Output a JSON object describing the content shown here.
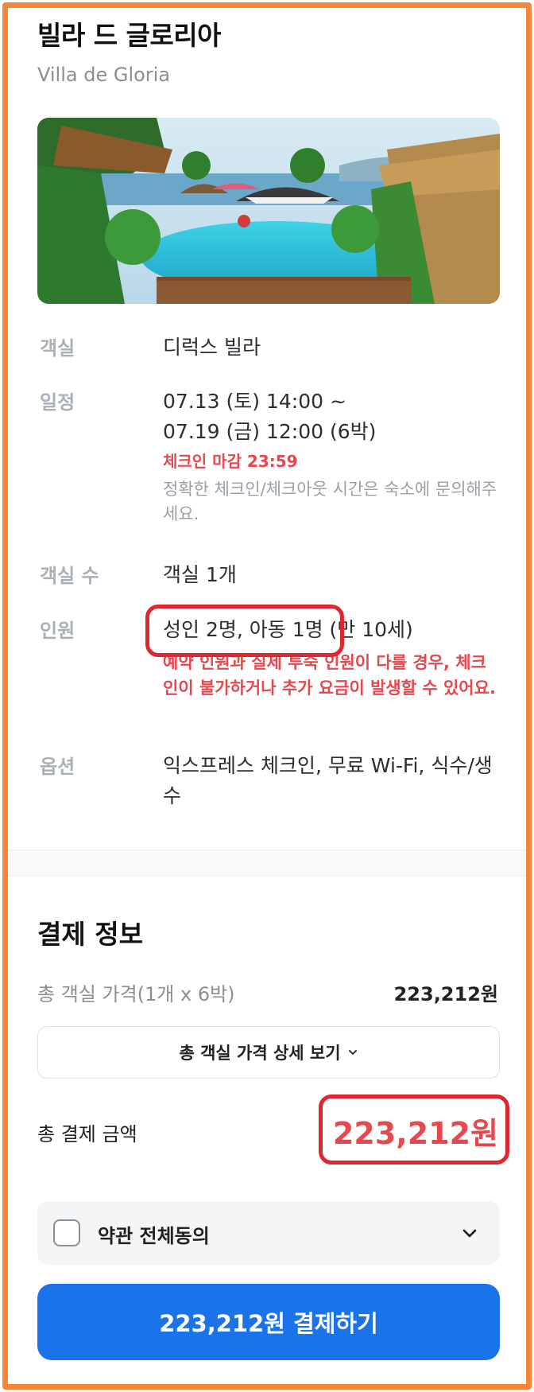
{
  "hotel": {
    "name": "빌라 드 글로리아",
    "name_en": "Villa de Gloria"
  },
  "details": {
    "room": {
      "label": "객실",
      "value": "디럭스 빌라"
    },
    "schedule": {
      "label": "일정",
      "line1": "07.13 (토) 14:00 ~",
      "line2": "07.19 (금) 12:00 (6박)",
      "checkin_deadline": "체크인 마감 23:59",
      "note": "정확한 체크인/체크아웃 시간은 숙소에 문의해주세요."
    },
    "room_count": {
      "label": "객실 수",
      "value": "객실 1개"
    },
    "guests": {
      "label": "인원",
      "value": "성인 2명, 아동 1명 (만 10세)",
      "warning": "예약 인원과 실제 투숙 인원이 다를 경우, 체크인이 불가하거나 추가 요금이 발생할 수 있어요."
    },
    "options": {
      "label": "옵션",
      "value": "익스프레스 체크인, 무료 Wi-Fi, 식수/생수"
    }
  },
  "payment": {
    "title": "결제 정보",
    "room_price_label": "총 객실 가격(1개 x 6박)",
    "room_price_value": "223,212원",
    "detail_button": "총 객실 가격 상세 보기",
    "total_label": "총 결제 금액",
    "total_value": "223,212원",
    "agree_label": "약관 전체동의",
    "pay_button": "223,212원 결제하기"
  },
  "colors": {
    "accent_red": "#E5484D",
    "pay_blue": "#1A73E8",
    "frame_orange": "#F5863A",
    "annotation_red": "#E0262F"
  },
  "icons": [
    "chevron-down-icon",
    "checkbox-icon"
  ]
}
